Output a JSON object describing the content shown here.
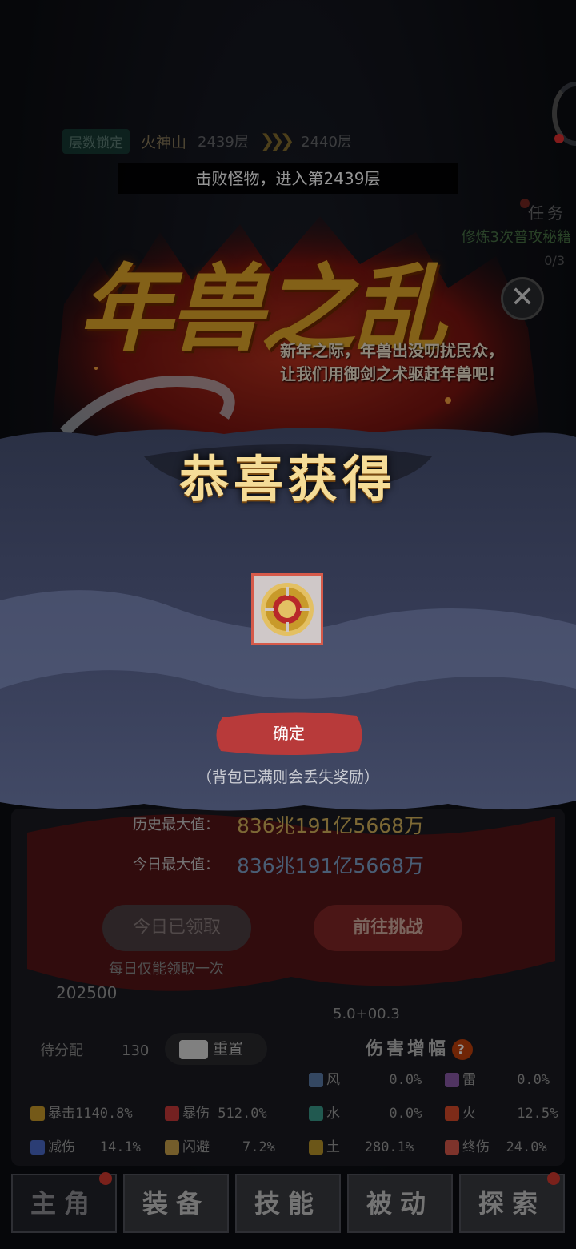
{
  "floor": {
    "lock_label": "层数锁定",
    "mountain": "火神山",
    "current": "2439层",
    "next": "2440层"
  },
  "toast": "击败怪物，进入第2439层",
  "task": {
    "title": "任务",
    "desc": "修炼3次普攻秘籍",
    "progress": "0/3"
  },
  "event": {
    "title": "年兽之乱",
    "subtitle_line1": "新年之际，年兽出没叨扰民众，",
    "subtitle_line2": "让我们用御剑之术驱赶年兽吧！"
  },
  "dialog": {
    "title": "恭喜获得",
    "item_icon": "gold-medallion-icon",
    "confirm": "确定",
    "note": "（背包已满则会丢失奖励）"
  },
  "records": {
    "history_label": "历史最大值：",
    "history_value": "836兆191亿5668万",
    "today_label": "今日最大值：",
    "today_value": "836兆191亿5668万"
  },
  "buttons": {
    "claimed": "今日已领取",
    "challenge": "前往挑战",
    "once_note": "每日仅能领取一次"
  },
  "misc": {
    "left_value": "202500",
    "mid_value": "5.0+00.3",
    "alloc_label": "待分配",
    "alloc_value": "130",
    "reset": "重置"
  },
  "damage": {
    "title": "伤害增幅",
    "help": "?"
  },
  "stats": [
    {
      "k": "风",
      "v": "0.0%"
    },
    {
      "k": "雷",
      "v": "0.0%"
    },
    {
      "k": "暴击",
      "v": "1140.8%"
    },
    {
      "k": "暴伤",
      "v": "512.0%"
    },
    {
      "k": "水",
      "v": "0.0%"
    },
    {
      "k": "火",
      "v": "12.5%"
    },
    {
      "k": "减伤",
      "v": "14.1%"
    },
    {
      "k": "闪避",
      "v": "7.2%"
    },
    {
      "k": "土",
      "v": "280.1%"
    },
    {
      "k": "终伤",
      "v": "24.0%"
    }
  ],
  "tabs": [
    "主角",
    "装备",
    "技能",
    "被动",
    "探索"
  ],
  "colors": {
    "accent_gold": "#e2a82a",
    "confirm_red": "#b83a3a",
    "badge_red": "#d23a30"
  }
}
